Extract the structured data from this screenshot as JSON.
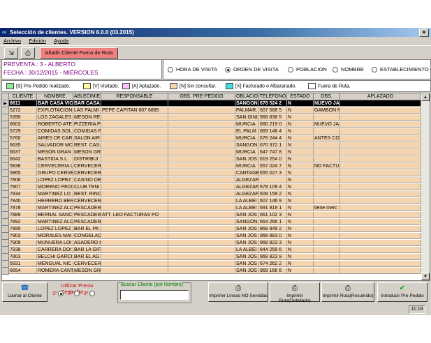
{
  "window": {
    "title": "Selección de clientes.  VERSION 6.0.0 (03.2015)"
  },
  "menu": [
    "Archivo",
    "Edición",
    "Ayuda"
  ],
  "toolbar": {
    "add_client_label": "Añadir Cliente Fuera de Ruta"
  },
  "info": {
    "preventa": "PREVENTA : 3 - ALBERTO",
    "fecha": "FECHA : 30/12/2015 - MIÉRCOLES"
  },
  "order_options": [
    {
      "label": "HORA DE VISITA",
      "selected": false
    },
    {
      "label": "ORDEN DE VISITA",
      "selected": true
    },
    {
      "label": "POBLACION",
      "selected": false
    },
    {
      "label": "NOMBRE",
      "selected": false
    },
    {
      "label": "ESTABLECIMIENTO",
      "selected": false
    }
  ],
  "legend": [
    {
      "label": "[S] Pre-Pedido realizado.",
      "color": "#90ee90"
    },
    {
      "label": "[V] Visitado.",
      "color": "#ffffa0"
    },
    {
      "label": "[A] Aplazado.",
      "color": "#ffc0ff"
    },
    {
      "label": "[N] Sin consultar.",
      "color": "#f5d5b0"
    },
    {
      "label": "[X] Facturado o Albaranado.",
      "color": "#40e0e0"
    },
    {
      "label": "Fuera de Ruta.",
      "color": "#ffffff"
    }
  ],
  "table": {
    "columns": [
      "CLIENTE",
      "NOMBRE",
      "ABLECIMIE",
      "RESPONSABLE",
      "OBS. PRE-PEDIDO",
      "OBLACIO",
      "TELEFONO",
      "ESTADO",
      "OBS.",
      "APLAZADO"
    ],
    "rows": [
      [
        "6611",
        "BAR CASA VIC",
        "BAR CASA",
        "",
        "",
        "SANGON",
        "678 524 2",
        "N",
        "NUEVO JA",
        ""
      ],
      [
        "5272",
        "EXPLOTACION",
        "LAS PALMI",
        "PEPE CAPITAN 607 6885",
        "",
        "PALMAR,",
        "607 688 5",
        "N",
        "GAMBON N",
        ""
      ],
      [
        "5390",
        "LOS ZAGALES",
        "MESON RE",
        "",
        "",
        "SAN GINI",
        "968 838 5",
        "N",
        "",
        ""
      ],
      [
        "6603",
        "ROBERTO ATE",
        "PIZZERIA P",
        "",
        "",
        "MURCIA",
        "680 219 0",
        "N",
        "NUEVO JA",
        ""
      ],
      [
        "5729",
        "COMIDAS SOL",
        "COMIDAS F",
        "",
        "",
        "EL PALM",
        "669 146 4",
        "N",
        "",
        ""
      ],
      [
        "5760",
        "AIRES DE CAR",
        "SALON AIR",
        "",
        "",
        "MURCIA",
        "676 244 4",
        "N",
        "ANTES CO",
        ""
      ],
      [
        "6635",
        "SALVADOR MC",
        "REST. CAS.",
        "",
        "",
        "SANGON",
        "670 372 1",
        "N",
        "",
        ""
      ],
      [
        "6637",
        "MESON GRAN",
        "MESON GR",
        "",
        "",
        "MURCIA",
        "647 747 8",
        "N",
        "",
        ""
      ],
      [
        "6642",
        "BASTIDA S.L.",
        "DISTRIBUI",
        "",
        "",
        "SAN JOS",
        "619 254 0",
        "N",
        "",
        ""
      ],
      [
        "5836",
        "CERVECERIA L",
        "CERVECER",
        "",
        "",
        "MURCIA",
        "657 024 7",
        "N",
        "NO FACTUI",
        ""
      ],
      [
        "5865",
        "GRUPO CERVE",
        "CERVECER",
        "",
        "",
        "CARTAGE",
        "655 027 3",
        "N",
        "",
        ""
      ],
      [
        "7806",
        "LOPEZ LOPEZ",
        "CASINO DE",
        "",
        "",
        "ALGEZAF",
        "",
        "N",
        "",
        ""
      ],
      [
        "7807",
        "MORENO PEDI",
        "CLUB TENI",
        "",
        "",
        "ALGEZAF",
        "678 109 4",
        "N",
        "",
        ""
      ],
      [
        "7834",
        "MARTINEZ LO",
        "REST. RINC",
        "",
        "",
        "ALGEZAF",
        "608 159 2",
        "N",
        "",
        ""
      ],
      [
        "7840",
        "HERRERO BER",
        "CERVECER",
        "",
        "",
        "LA ALBEI",
        "607 146 9",
        "N",
        "",
        ""
      ],
      [
        "7878",
        "MARTINEZ ALC",
        "PESCADER",
        "",
        "",
        "LA ALBEI",
        "691 819 1",
        "N",
        "tiene merc",
        ""
      ],
      [
        "7889",
        "BERNAL SANC",
        "PESCADER",
        "ATT. LEO FACTURAS PO",
        "",
        "SAN JOS",
        "661 102 3",
        "N",
        "",
        ""
      ],
      [
        "7892",
        "MARTINEZ ALC",
        "PESCADER",
        "",
        "",
        "SANGON",
        "664 266 1",
        "N",
        "",
        ""
      ],
      [
        "7895",
        "LOPEZ LOPEZ",
        "BAR EL PA",
        "",
        "",
        "SAN JOS",
        "868 949 2",
        "N",
        "",
        ""
      ],
      [
        "7903",
        "MORALES MAI",
        "CONGELAD",
        "",
        "",
        "SAN JOS",
        "968 883 0",
        "N",
        "",
        ""
      ],
      [
        "7909",
        "MUNUERA LOI",
        "ASADERO I",
        "",
        "",
        "SAN JOS",
        "968 823 3",
        "N",
        "",
        ""
      ],
      [
        "7938",
        "CARRERA DOI",
        "BAR LA GIF",
        "",
        "",
        "LA ALBEI",
        "644 259 6",
        "N",
        "",
        ""
      ],
      [
        "7803",
        "BELCHI GARCI",
        "BAR EL AG",
        "",
        "",
        "SAN JOS",
        "968 823 9",
        "N",
        "",
        ""
      ],
      [
        "5931",
        "MENGUAL NIC",
        "CERVECER",
        "",
        "",
        "SAN JOS",
        "674 262 2",
        "N",
        "",
        ""
      ],
      [
        "6654",
        "ROMERA CANT",
        "MESON GR",
        "",
        "",
        "SAN JOS",
        "969 166 6",
        "N",
        "",
        ""
      ]
    ]
  },
  "bottom": {
    "call_client": "Llamar al Cliente",
    "precio_title": "Utilizar Precio Centralita",
    "precio_options": [
      "1º",
      "2º",
      "3º"
    ],
    "precio_selected": 0,
    "search_title": "Buscar Cliente (por Nombre)",
    "search_value": "",
    "print_no_served": "Imprimir Líneas NO Servidas",
    "print_route_detailed": "Imprimir Ruta(Detallado)",
    "print_route_summary": "Imprimir Ruta(Resumido)",
    "introduce_preorder": "Introducir Pre-Pedido"
  },
  "status": {
    "time": "11:18"
  },
  "colors": {
    "row_bg": "#f5d5b0",
    "selected_row_bg": "#000000",
    "selected_row_fg": "#ffffff"
  }
}
